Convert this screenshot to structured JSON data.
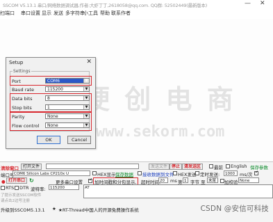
{
  "window": {
    "title": "SSCOM V5.13.1 串口/网络数据调试器,作者:大虾丁丁,2618058@qq.com. QQ群: 52502449(最新版本)",
    "minimize": "—",
    "close": "✕"
  },
  "menu": [
    "打开文件",
    "串口设置",
    "显示",
    "发送",
    "多字符串",
    "小工具",
    "帮助",
    "联系作者"
  ],
  "menu_first_partial": "扫端口",
  "watermark": {
    "line1": "硬 创 电 商",
    "line2": "www.sekorm.com"
  },
  "dialog": {
    "title": "Setup",
    "close": "✕",
    "group": "Settings",
    "fields": [
      {
        "label": "Port",
        "value": "COM6"
      },
      {
        "label": "Baud rate",
        "value": "115200"
      },
      {
        "label": "Data bits",
        "value": "8"
      },
      {
        "label": "Stop bits",
        "value": "1"
      },
      {
        "label": "Parity",
        "value": "None"
      },
      {
        "label": "Flow control",
        "value": "None"
      }
    ],
    "ok": "OK",
    "cancel": "Cancel"
  },
  "toolbar": {
    "clear_window": "清除窗口",
    "open_file": "打开文件",
    "send_file": "发送文件",
    "stop": "停止",
    "clear_send": "清发送区",
    "top": "最前",
    "english": "English",
    "save_params": "保存参数",
    "port_label": "端口号",
    "port_value": "COM6 Silicon Labs CP210x U",
    "hex_display": "HEX显示",
    "save_data": "保存数据",
    "recv_to_file": "接收数据到文件",
    "hex_send": "HEX发送",
    "timed_send": "定时发送:",
    "interval": "1000",
    "interval_unit": "ms/次",
    "open_port": "打开串口",
    "more_settings": "更多串口设置",
    "add_timestamp": "加时间戳和分包显示,",
    "timeout_label": "超时时间:",
    "timeout_value": "20",
    "timeout_unit": "ms",
    "byte_label": "第",
    "byte_value": "1",
    "byte_unit": "字节 至",
    "end_value": "末尾",
    "checksum": "加校验",
    "checksum_value": "None",
    "rts": "RTS",
    "dtr": "DTR",
    "baud_label": "波特率:",
    "baud_value": "115200",
    "at_text": "AT",
    "hint1": "了提示发送SSCOM软件",
    "hint2": "请点击2边号注册",
    "upgrade": "升级到SSCOM5.13.1",
    "star": "★",
    "ad": "★RT-Thread中国人的开源免费操作系统"
  },
  "credit": "CSDN @安信可科技"
}
